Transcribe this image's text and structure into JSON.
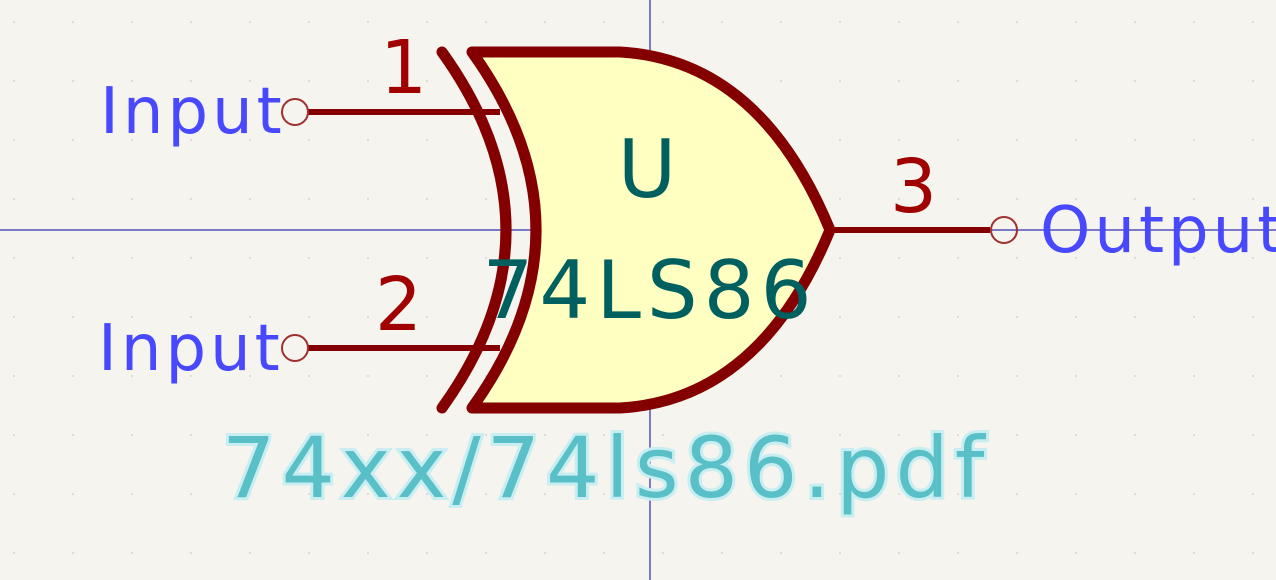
{
  "symbol": {
    "reference": "U",
    "value": "74LS86",
    "datasheet": "74xx/74ls86.pdf",
    "gate_type": "xor-gate",
    "pins": [
      {
        "number": "1",
        "name": "Input"
      },
      {
        "number": "2",
        "name": "Input"
      },
      {
        "number": "3",
        "name": "Output"
      }
    ]
  },
  "colors": {
    "background": "#f5f4ef",
    "body_outline": "#840000",
    "body_fill": "#ffffc2",
    "pin_name": "#4848ff",
    "pin_number": "#a00000",
    "reference_value": "#006060",
    "datasheet": "#5ac0c8",
    "crosshair": "#0000a0"
  }
}
